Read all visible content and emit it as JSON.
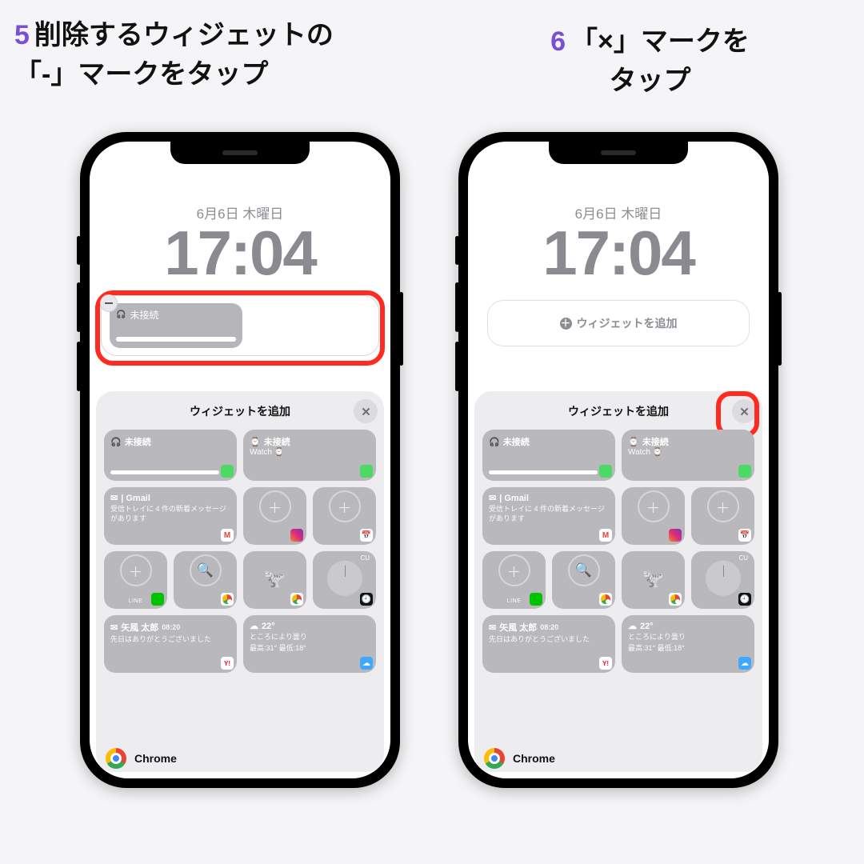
{
  "instructions": {
    "step5": {
      "num": "5",
      "text": "削除するウィジェットの\n「-」マークをタップ"
    },
    "step6": {
      "num": "6",
      "text": "「×」マークを\nタップ"
    }
  },
  "lockscreen": {
    "date": "6月6日 木曜日",
    "time": "17:04",
    "widget_slot": {
      "title": "未接続"
    },
    "add_widget_label": "ウィジェットを追加"
  },
  "sheet": {
    "title": "ウィジェットを追加",
    "rows": {
      "airpods": {
        "title": "未接続"
      },
      "watch": {
        "title": "未接続",
        "subtitle": "Watch"
      },
      "gmail": {
        "title": "| Gmail",
        "desc": "受信トレイに 4 件の新着メッセージがあります"
      },
      "mail": {
        "from": "矢風 太郎",
        "time": "08:20",
        "body": "先日はありがとうございました"
      },
      "weather": {
        "temp": "22°",
        "cond": "ところにより曇り",
        "range": "最高:31° 最低:18°"
      },
      "line": {
        "label": "LINE"
      },
      "clock": {
        "label": "CU"
      }
    }
  },
  "suggested_app": {
    "name": "Chrome"
  },
  "colors": {
    "accent_red": "#ff2a20",
    "num_purple": "#7a4fd6"
  }
}
